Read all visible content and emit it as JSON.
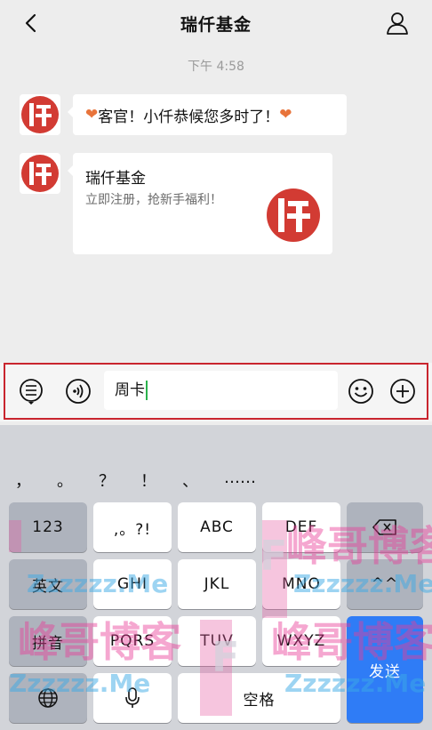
{
  "header": {
    "title": "瑞仟基金",
    "back_icon": "chevron-left-icon",
    "profile_icon": "person-icon"
  },
  "chat": {
    "timestamp": "下午 4:58",
    "messages": [
      {
        "text": "客官！小仟恭候您多时了！",
        "heart": "❤"
      },
      {
        "card_title": "瑞仟基金",
        "card_subtitle": "立即注册，抢新手福利！"
      }
    ]
  },
  "input": {
    "value": "周卡",
    "menu_icon": "list-menu-icon",
    "voice_icon": "voice-icon",
    "emoji_icon": "emoji-icon",
    "plus_icon": "plus-icon"
  },
  "keyboard": {
    "punctuation": [
      "，",
      "。",
      "？",
      "！",
      "、",
      "……"
    ],
    "row1": {
      "num": "123",
      "punct": ",。?!",
      "k2": "ABC",
      "k3": "DEF"
    },
    "row2": {
      "lang": "英文",
      "k1": "GHI",
      "k2": "JKL",
      "k3": "MNO",
      "face": "^^"
    },
    "row3": {
      "pinyin": "拼音",
      "k1": "PQRS",
      "k2": "TUV",
      "k3": "WXYZ"
    },
    "row4": {
      "space": "空格"
    },
    "send": "发送"
  },
  "watermark": {
    "text_big": "峰哥博客",
    "text_small": "Zzzzzz.Me",
    "letter": "F"
  },
  "colors": {
    "brand_red": "#d23b33",
    "highlight_frame": "#c9252e",
    "send_blue": "#2f7cf6",
    "caret_green": "#2bb24c"
  }
}
